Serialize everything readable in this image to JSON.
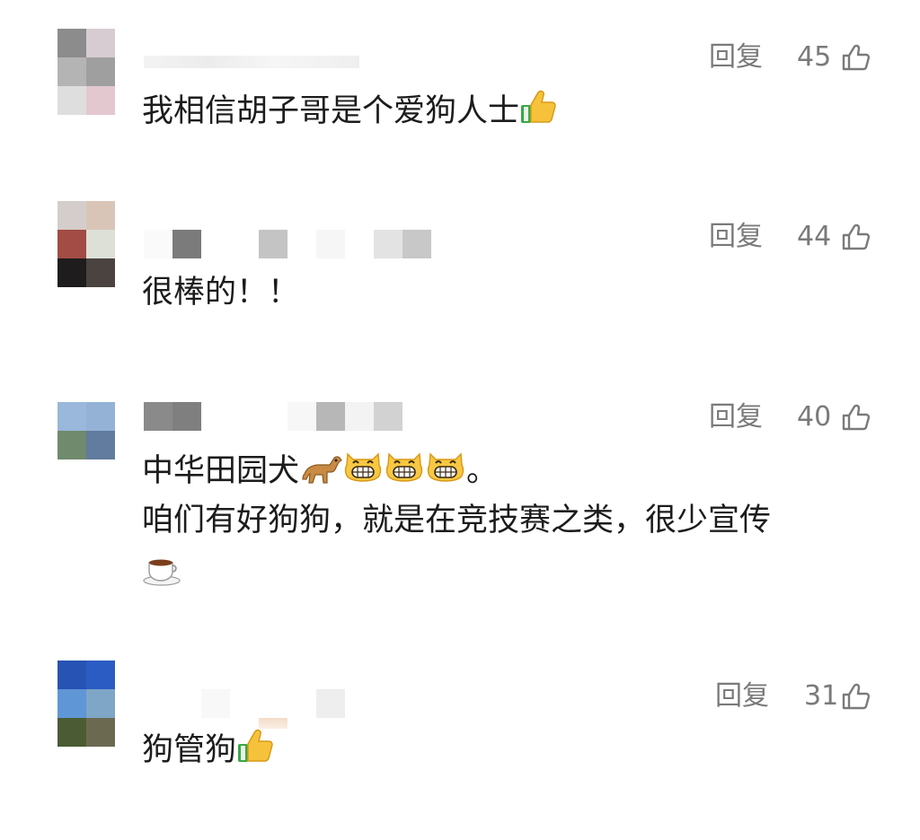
{
  "comments": [
    {
      "reply_label": "回复",
      "likes": "45",
      "text": "我相信胡子哥是个爱狗人士",
      "avatar_colors": [
        "#8c8c8c",
        "#d6ccd2",
        "#b4b4b4",
        "#9f9f9f",
        "#dedede",
        "#e3c8cf"
      ],
      "emoji": [
        "thumbs-up-icon"
      ]
    },
    {
      "reply_label": "回复",
      "likes": "44",
      "text": "很棒的！！",
      "avatar_colors": [
        "#d4cdcb",
        "#d9c5b8",
        "#a24c45",
        "#dde0d7",
        "#1e1c1c",
        "#4a4340"
      ]
    },
    {
      "reply_label": "回复",
      "likes": "40",
      "text_line1": "中华田园犬",
      "text_line1_end": "。",
      "text_line2": "咱们有好狗狗，就是在竞技赛之类，很少宣传",
      "avatar_colors": [
        "#9ab7dc",
        "#93b2d6",
        "#6f8a6d",
        "#617c9e"
      ],
      "emoji": [
        "dog-icon",
        "grinning-cat-icon",
        "grinning-cat-icon",
        "grinning-cat-icon",
        "coffee-cup-icon"
      ]
    },
    {
      "reply_label": "回复",
      "likes": "31",
      "text": "狗管狗",
      "avatar_colors": [
        "#2753b4",
        "#2b5cc4",
        "#5f96d6",
        "#7fa6c6",
        "#4b5b34",
        "#6b6a51"
      ],
      "emoji": [
        "thumbs-up-icon"
      ]
    }
  ]
}
